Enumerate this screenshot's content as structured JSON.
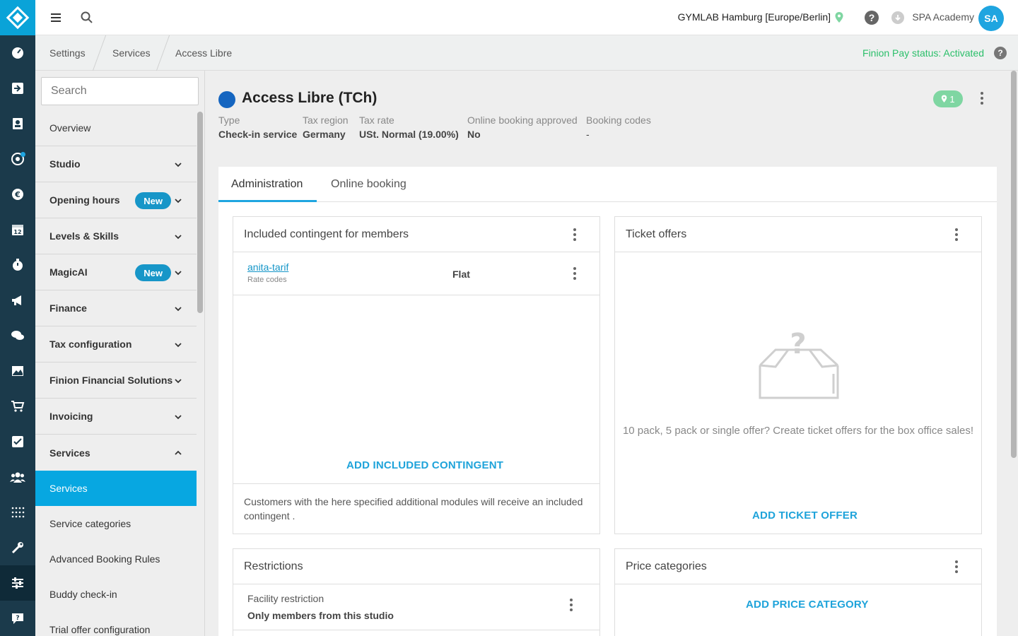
{
  "topbar": {
    "studio": "GYMLAB Hamburg [Europe/Berlin]",
    "user": "SPA Academy",
    "avatar_initials": "SA"
  },
  "rail": {
    "icons": [
      "dashboard-icon",
      "checkin-icon",
      "contacts-icon",
      "target-icon",
      "euro-icon",
      "calendar-icon",
      "stopwatch-icon",
      "megaphone-icon",
      "chat-icon",
      "image-icon",
      "cart-icon",
      "checklist-icon",
      "people-icon",
      "grid-dots-icon",
      "tools-icon",
      "settings-sliders-icon",
      "support-icon"
    ],
    "calendar_day": "12"
  },
  "breadcrumb": {
    "items": [
      "Settings",
      "Services",
      "Access Libre"
    ],
    "finion_status": "Finion Pay status: Activated"
  },
  "sidenav": {
    "search_placeholder": "Search",
    "items": [
      {
        "label": "Overview"
      },
      {
        "label": "Studio"
      },
      {
        "label": "Opening hours",
        "badge": "New"
      },
      {
        "label": "Levels & Skills"
      },
      {
        "label": "MagicAI",
        "badge": "New"
      },
      {
        "label": "Finance"
      },
      {
        "label": "Tax configuration"
      },
      {
        "label": "Finion Financial Solutions"
      },
      {
        "label": "Invoicing"
      },
      {
        "label": "Services"
      }
    ],
    "sub_items": [
      "Services",
      "Service categories",
      "Advanced Booking Rules",
      "Buddy check-in",
      "Trial offer configuration"
    ]
  },
  "service": {
    "title": "Access Libre (TCh)",
    "location_count": "1",
    "meta": [
      {
        "label": "Type",
        "value": "Check-in service"
      },
      {
        "label": "Tax region",
        "value": "Germany"
      },
      {
        "label": "Tax rate",
        "value": "USt. Normal (19.00%)"
      },
      {
        "label": "Online booking approved",
        "value": "No"
      },
      {
        "label": "Booking codes",
        "value": "-"
      }
    ],
    "color": "#1565c0"
  },
  "tabs": [
    "Administration",
    "Online booking"
  ],
  "panels": {
    "contingent": {
      "title": "Included contingent for members",
      "row_link": "anita-tarif",
      "row_sub": "Rate codes",
      "row_value": "Flat",
      "add_label": "ADD INCLUDED CONTINGENT",
      "footer": "Customers with the here specified additional modules will receive an included contingent ."
    },
    "tickets": {
      "title": "Ticket offers",
      "empty_text": "10 pack, 5 pack or single offer? Create ticket offers for the box office sales!",
      "add_label": "ADD TICKET OFFER"
    },
    "restrictions": {
      "title": "Restrictions",
      "row_label": "Facility restriction",
      "row_value": "Only members from this studio"
    },
    "prices": {
      "title": "Price categories",
      "add_label": "ADD PRICE CATEGORY"
    }
  },
  "colors": {
    "accent": "#07a7e1",
    "rail": "#1b3a4b",
    "success": "#2bbf6a"
  }
}
